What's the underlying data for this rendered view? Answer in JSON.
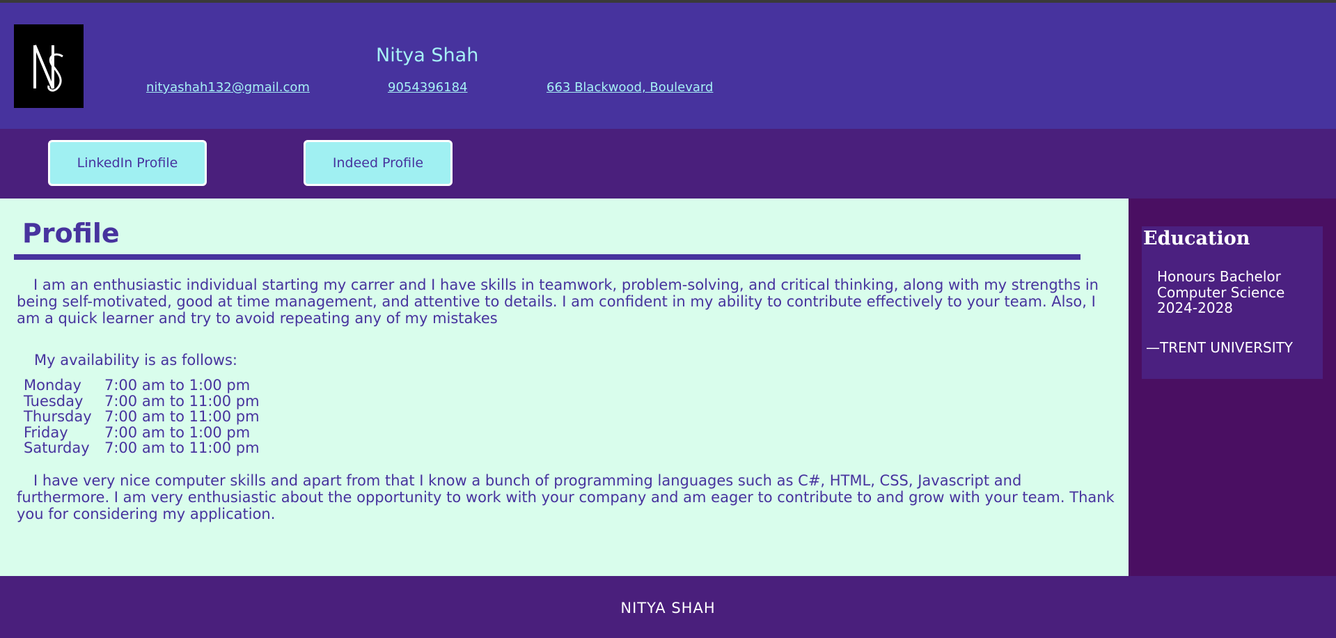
{
  "header": {
    "logo_icon": "ns-monogram-logo",
    "name": "Nitya Shah",
    "email": "nityashah132@gmail.com",
    "phone": "9054396184",
    "address": "663 Blackwood, Boulevard"
  },
  "nav": {
    "linkedin_label": "LinkedIn Profile",
    "indeed_label": "Indeed Profile"
  },
  "profile": {
    "heading": "Profile",
    "intro": "I am an enthusiastic individual starting my carrer and I have skills in teamwork, problem-solving, and critical thinking, along with my strengths in being self-motivated, good at time management, and attentive to details. I am confident in my ability to contribute effectively to your team. Also, I am a quick learner and try to avoid repeating any of my mistakes",
    "availability_title": "My availability is as follows:",
    "schedule": [
      {
        "day": "Monday",
        "hours": "7:00 am to 1:00 pm"
      },
      {
        "day": "Tuesday",
        "hours": "7:00 am to 11:00 pm"
      },
      {
        "day": "Thursday",
        "hours": "7:00 am to 11:00 pm"
      },
      {
        "day": "Friday",
        "hours": "7:00 am to 1:00 pm"
      },
      {
        "day": "Saturday",
        "hours": "7:00 am to 11:00 pm"
      }
    ],
    "closing": "I have very nice computer skills and apart from that I know a bunch of programming languages such as C#, HTML, CSS, Javascript and furthermore. I am very enthusiastic about the opportunity to work with your company and am eager to contribute to and grow with your team. Thank you for considering my application."
  },
  "education": {
    "heading": "Education",
    "degree": "Honours Bachelor",
    "program": "Computer Science",
    "years": "2024-2028",
    "university": "—TRENT UNIVERSITY"
  },
  "footer": {
    "text": "NITYA SHAH"
  },
  "colors": {
    "header_bg": "#47339e",
    "nav_bg": "#4a1f7c",
    "main_bg": "#d9fdec",
    "accent_text": "#47339e",
    "link_color": "#a6f0f5",
    "button_bg": "#a0f0f2",
    "aside_bg": "#4a0f62"
  }
}
